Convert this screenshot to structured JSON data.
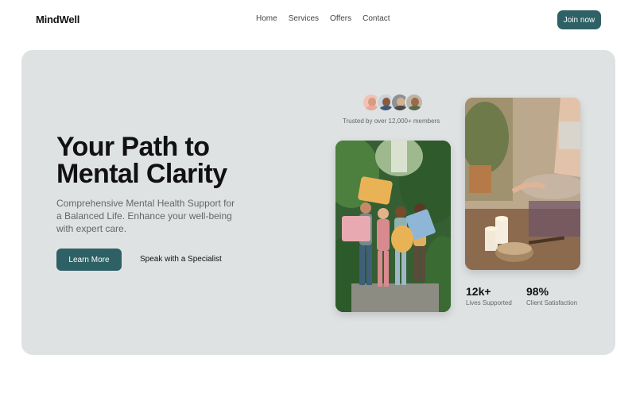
{
  "header": {
    "logo": "MindWell",
    "nav": [
      "Home",
      "Services",
      "Offers",
      "Contact"
    ],
    "cta": "Join now"
  },
  "hero": {
    "headline_line1": "Your Path to",
    "headline_line2": "Mental Clarity",
    "subtext": "Comprehensive Mental Health Support for a Balanced Life. Enhance your well-being with expert care.",
    "primary_button": "Learn More",
    "secondary_link": "Speak with a Specialist",
    "trusted_text": "Trusted by over 12,000+ members",
    "stats": [
      {
        "value": "12k+",
        "label": "Lives Supported"
      },
      {
        "value": "98%",
        "label": "Client Satisfaction"
      }
    ]
  },
  "colors": {
    "accent": "#2e6166",
    "hero_bg": "#dfe2e3",
    "body_text": "#666666"
  }
}
